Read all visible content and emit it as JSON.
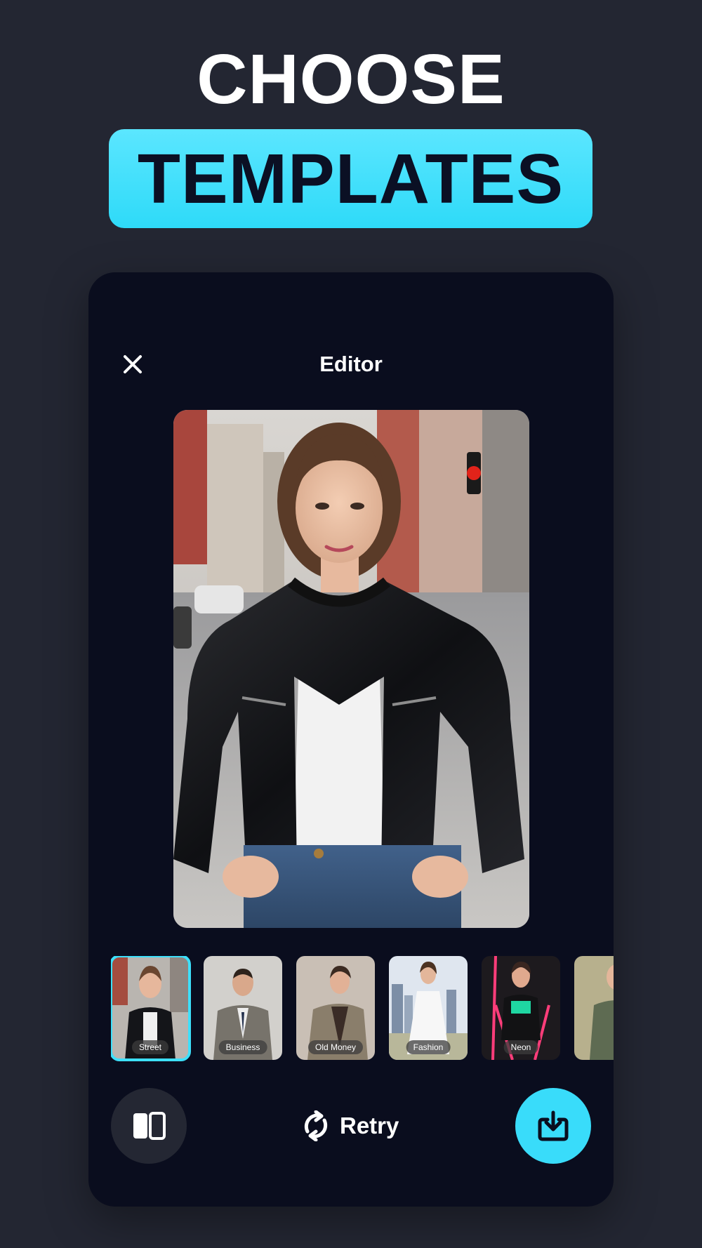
{
  "headline": {
    "line1": "CHOOSE",
    "line2": "TEMPLATES"
  },
  "editor": {
    "title": "Editor",
    "close_icon": "close-icon",
    "main_image": "portrait of woman in black leather jacket on city street"
  },
  "templates": [
    {
      "label": "Street",
      "selected": true
    },
    {
      "label": "Business",
      "selected": false
    },
    {
      "label": "Old Money",
      "selected": false
    },
    {
      "label": "Fashion",
      "selected": false
    },
    {
      "label": "Neon",
      "selected": false
    },
    {
      "label": "",
      "selected": false
    }
  ],
  "actions": {
    "compare_icon": "compare-icon",
    "retry_label": "Retry",
    "retry_icon": "refresh-icon",
    "download_icon": "download-icon"
  },
  "colors": {
    "background": "#232632",
    "card": "#0a0d1e",
    "accent": "#39dcfa",
    "headline_dark_text": "#0b1024"
  }
}
